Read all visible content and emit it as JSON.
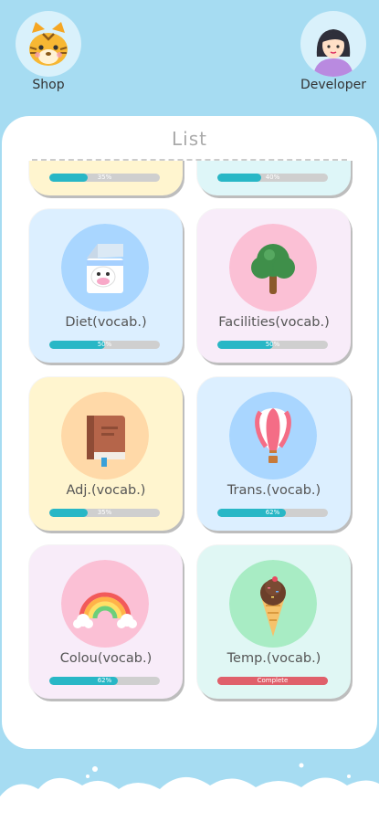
{
  "shop": {
    "label": "Shop",
    "icon": "tiger-face-icon"
  },
  "developer": {
    "label": "Developer",
    "icon": "girl-avatar-icon"
  },
  "list": {
    "title": "List"
  },
  "partial_cards": [
    {
      "bg": "#fff5cf",
      "progress": 0.35,
      "pct_label": "35%"
    },
    {
      "bg": "#def6f8",
      "progress": 0.4,
      "pct_label": "40%"
    }
  ],
  "cards": [
    {
      "title": "Diet(vocab.)",
      "icon": "milk-carton-icon",
      "bg": "#dcefff",
      "circle": "#a9d6ff",
      "progress": 0.5,
      "pct_label": "50%",
      "complete": false
    },
    {
      "title": "Facilities(vocab.)",
      "icon": "tree-icon",
      "bg": "#f8ecf9",
      "circle": "#fbc0d5",
      "progress": 0.5,
      "pct_label": "50%",
      "complete": false
    },
    {
      "title": "Adj.(vocab.)",
      "icon": "book-icon",
      "bg": "#fff5cf",
      "circle": "#ffd9a8",
      "progress": 0.35,
      "pct_label": "35%",
      "complete": false
    },
    {
      "title": "Trans.(vocab.)",
      "icon": "hot-air-balloon-icon",
      "bg": "#dcefff",
      "circle": "#a9d6ff",
      "progress": 0.62,
      "pct_label": "62%",
      "complete": false
    },
    {
      "title": "Colou(vocab.)",
      "icon": "rainbow-icon",
      "bg": "#f8ecf9",
      "circle": "#fbc0d5",
      "progress": 0.62,
      "pct_label": "62%",
      "complete": false
    },
    {
      "title": "Temp.(vocab.)",
      "icon": "ice-cream-cone-icon",
      "bg": "#e0f7f4",
      "circle": "#a8ecc4",
      "progress": 1.0,
      "pct_label": "Complete",
      "complete": true
    }
  ]
}
